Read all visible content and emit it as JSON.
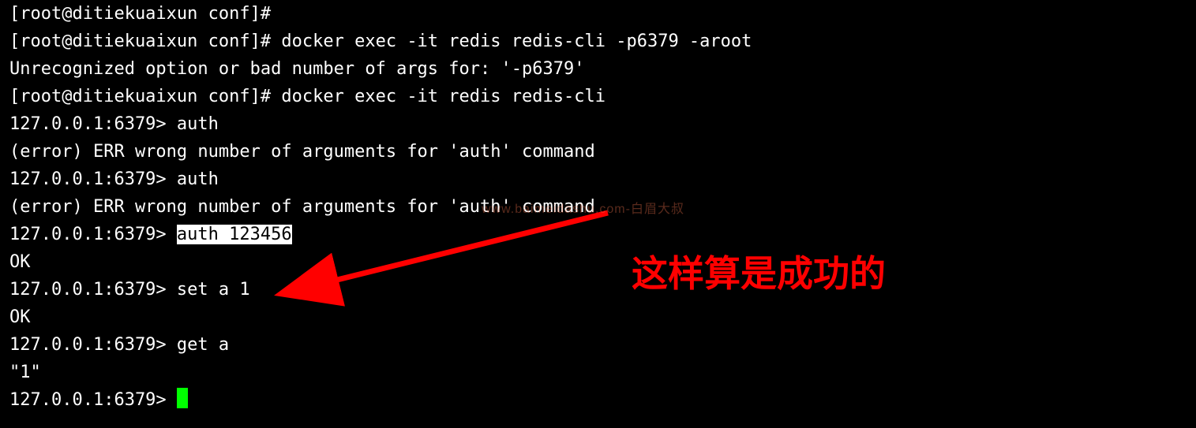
{
  "terminal": {
    "lines": [
      {
        "prompt": "[root@ditiekuaixun conf]# ",
        "cmd": ""
      },
      {
        "prompt": "[root@ditiekuaixun conf]# ",
        "cmd": "docker exec -it redis redis-cli -p6379 -aroot"
      },
      {
        "text": "Unrecognized option or bad number of args for: '-p6379'"
      },
      {
        "prompt": "[root@ditiekuaixun conf]# ",
        "cmd": "docker exec -it redis redis-cli"
      },
      {
        "prompt": "127.0.0.1:6379> ",
        "cmd": "auth"
      },
      {
        "text": "(error) ERR wrong number of arguments for 'auth' command"
      },
      {
        "prompt": "127.0.0.1:6379> ",
        "cmd": "auth"
      },
      {
        "text": "(error) ERR wrong number of arguments for 'auth' command"
      },
      {
        "prompt": "127.0.0.1:6379> ",
        "cmd_hl": "auth 123456"
      },
      {
        "text": "OK"
      },
      {
        "prompt": "127.0.0.1:6379> ",
        "cmd": "set a 1"
      },
      {
        "text": "OK"
      },
      {
        "prompt": "127.0.0.1:6379> ",
        "cmd": "get a"
      },
      {
        "text": "\"1\""
      },
      {
        "prompt": "127.0.0.1:6379> ",
        "cursor": true
      }
    ]
  },
  "watermark": "www.baimeidashu.com-白眉大叔",
  "annotation": "这样算是成功的"
}
